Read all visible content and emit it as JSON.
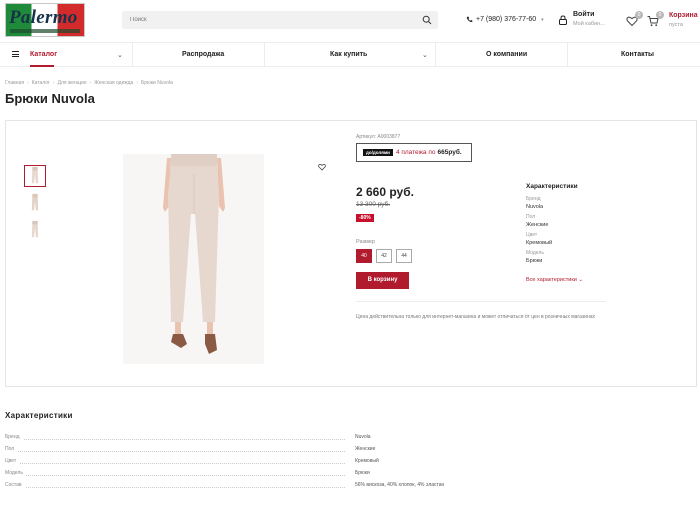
{
  "brand": {
    "logo_text": "Palermo"
  },
  "header": {
    "search_placeholder": "Поиск",
    "phone": "+7 (980) 376-77-60",
    "login_label": "Войти",
    "login_sub": "Мой кабин...",
    "favorites_count": "0",
    "cart_count": "0",
    "cart_label": "Корзина",
    "cart_sub": "пуста"
  },
  "nav": {
    "items": [
      {
        "label": "Каталог"
      },
      {
        "label": "Распродажа"
      },
      {
        "label": "Как купить"
      },
      {
        "label": "О компании"
      },
      {
        "label": "Контакты"
      }
    ]
  },
  "breadcrumb": [
    "Главная",
    "Каталог",
    "Для женщин",
    "Женская одежда",
    "Брюки Nuvola"
  ],
  "product": {
    "title": "Брюки Nuvola",
    "sku": "Артикул: А0003877",
    "installment": {
      "badge": "до/долями",
      "text": "4 платежа по",
      "amount": "665руб."
    },
    "price": "2 660 руб.",
    "old_price": "13 300 руб.",
    "discount": "-80%",
    "size_label": "Размер",
    "sizes": [
      "40",
      "42",
      "44"
    ],
    "selected_size": "40",
    "add_to_cart": "В корзину",
    "chars_title": "Характеристики",
    "chars": [
      {
        "k": "Бренд",
        "v": "Nuvola"
      },
      {
        "k": "Пол",
        "v": "Женские"
      },
      {
        "k": "Цвет",
        "v": "Кремовый"
      },
      {
        "k": "Модель",
        "v": "Брюки"
      }
    ],
    "all_chars": "Все характеристики ⌄",
    "note": "Цена действительна только для интернет-магазина и может отличаться от цен в розничных магазинах"
  },
  "specs": {
    "title": "Характеристики",
    "rows": [
      {
        "k": "Бренд",
        "v": "Nuvola"
      },
      {
        "k": "Пол",
        "v": "Женские"
      },
      {
        "k": "Цвет",
        "v": "Кремовый"
      },
      {
        "k": "Модель",
        "v": "Брюки"
      },
      {
        "k": "Состав",
        "v": "56% вискоза, 40% хлопок, 4% эластан"
      }
    ]
  },
  "colors": {
    "accent": "#b01c2e",
    "discount": "#c8102e",
    "pants": "#e7d8cf"
  }
}
